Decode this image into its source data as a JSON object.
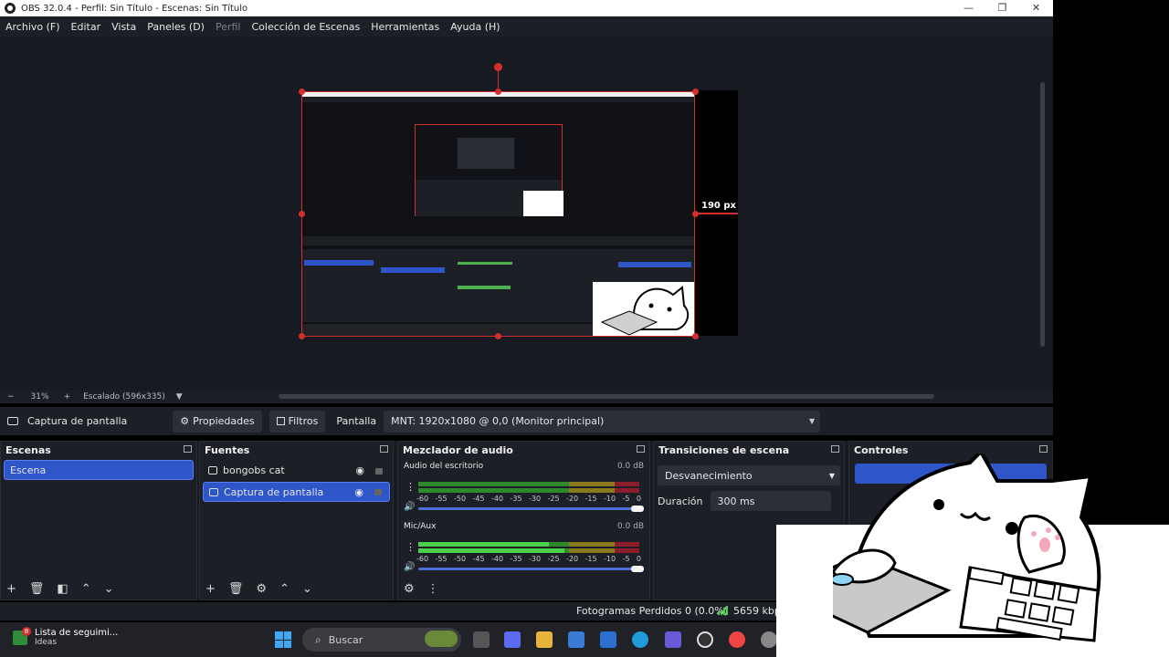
{
  "window": {
    "title": "OBS 32.0.4 - Perfil: Sin Título - Escenas: Sin Título",
    "controls": [
      "—",
      "❐",
      "✕"
    ]
  },
  "menu": [
    {
      "label": "Archivo (F)",
      "enabled": true
    },
    {
      "label": "Editar",
      "enabled": true
    },
    {
      "label": "Vista",
      "enabled": true
    },
    {
      "label": "Paneles (D)",
      "enabled": true
    },
    {
      "label": "Perfil",
      "enabled": false
    },
    {
      "label": "Colección de Escenas",
      "enabled": true
    },
    {
      "label": "Herramientas",
      "enabled": true
    },
    {
      "label": "Ayuda (H)",
      "enabled": true
    }
  ],
  "preview": {
    "measure_label": "190 px",
    "accent": "#d32f2f"
  },
  "zoombar": {
    "minus": "−",
    "zoom": "31%",
    "plus": "+",
    "scale": "Escalado (596x335)",
    "dropdown": "▼"
  },
  "properties_bar": {
    "source_name": "Captura de pantalla",
    "properties_label": "Propiedades",
    "filters_label": "Filtros",
    "display_label": "Pantalla",
    "display_value": "MNT: 1920x1080 @ 0,0 (Monitor principal)"
  },
  "scenes": {
    "title": "Escenas",
    "items": [
      "Escena"
    ],
    "selected": 0
  },
  "sources": {
    "title": "Fuentes",
    "items": [
      "bongobs cat",
      "Captura de pantalla"
    ],
    "selected": 1
  },
  "mixer": {
    "title": "Mezclador de audio",
    "channels": [
      {
        "name": "Audio del escritorio",
        "db": "0.0 dB",
        "level": 0
      },
      {
        "name": "Mic/Aux",
        "db": "0.0 dB",
        "level": 0.6
      }
    ],
    "scale": [
      "-60",
      "-55",
      "-50",
      "-45",
      "-40",
      "-35",
      "-30",
      "-25",
      "-20",
      "-15",
      "-10",
      "-5",
      "0"
    ]
  },
  "transitions": {
    "title": "Transiciones de escena",
    "type": "Desvanecimiento",
    "duration_label": "Duración",
    "duration_value": "300 ms"
  },
  "controls": {
    "title": "Controles"
  },
  "status": {
    "dropped": "Fotogramas Perdidos 0 (0.0%)",
    "bitrate": "5659 kbps",
    "status_color": "#4cd04c"
  },
  "taskbar": {
    "widget_title": "Lista de seguimi...",
    "widget_sub": "Ideas",
    "widget_badge": "8",
    "search_placeholder": "Buscar"
  }
}
